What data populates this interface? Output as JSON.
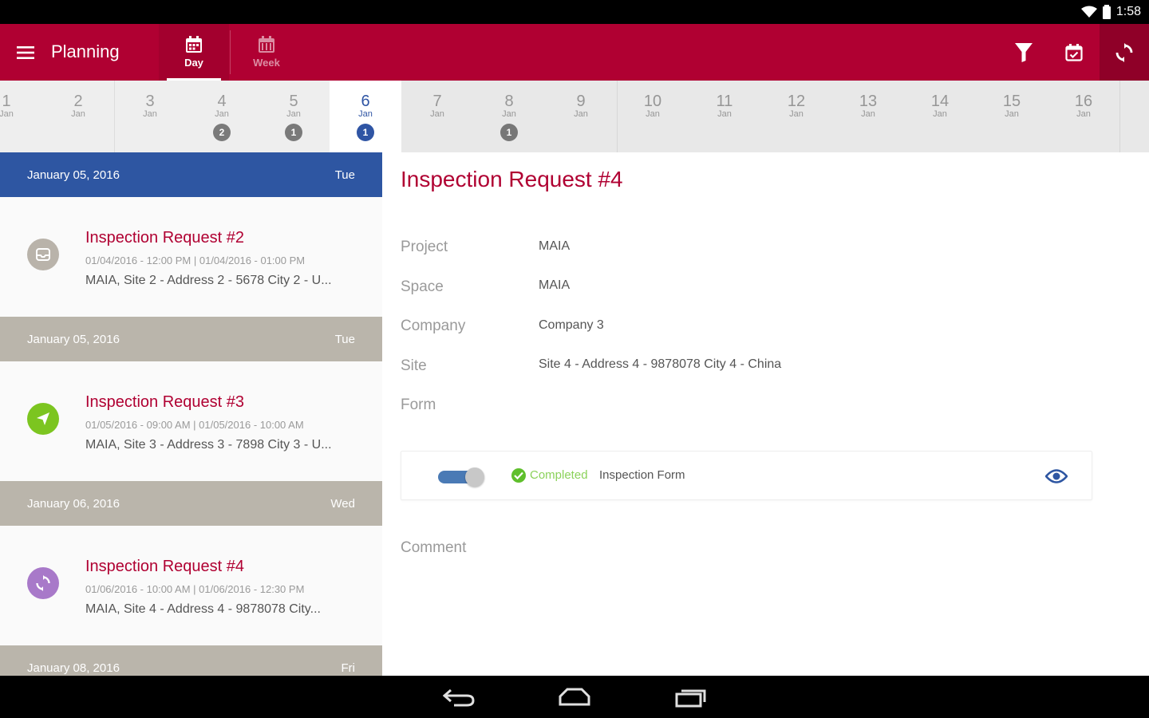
{
  "status_bar": {
    "time": "1:58"
  },
  "app_bar": {
    "title": "Planning",
    "view_tabs": [
      {
        "label": "Day",
        "icon": "calendar-day-icon"
      },
      {
        "label": "Week",
        "icon": "calendar-week-icon"
      }
    ],
    "actions": [
      {
        "icon": "filter-icon"
      },
      {
        "icon": "calendar-today-icon"
      },
      {
        "icon": "sync-icon"
      }
    ]
  },
  "date_strip": {
    "days": [
      {
        "num": "1",
        "month": "Jan",
        "count": ""
      },
      {
        "num": "2",
        "month": "Jan",
        "count": ""
      },
      {
        "num": "3",
        "month": "Jan",
        "count": ""
      },
      {
        "num": "4",
        "month": "Jan",
        "count": "2"
      },
      {
        "num": "5",
        "month": "Jan",
        "count": "1"
      },
      {
        "num": "6",
        "month": "Jan",
        "count": "1",
        "selected": true
      },
      {
        "num": "7",
        "month": "Jan",
        "count": ""
      },
      {
        "num": "8",
        "month": "Jan",
        "count": "1"
      },
      {
        "num": "9",
        "month": "Jan",
        "count": ""
      },
      {
        "num": "10",
        "month": "Jan",
        "count": ""
      },
      {
        "num": "11",
        "month": "Jan",
        "count": ""
      },
      {
        "num": "12",
        "month": "Jan",
        "count": ""
      },
      {
        "num": "13",
        "month": "Jan",
        "count": ""
      },
      {
        "num": "14",
        "month": "Jan",
        "count": ""
      },
      {
        "num": "15",
        "month": "Jan",
        "count": ""
      },
      {
        "num": "16",
        "month": "Jan",
        "count": ""
      }
    ]
  },
  "list": {
    "headers": [
      {
        "date": "January 05, 2016",
        "weekday": "Tue"
      },
      {
        "date": "January 05, 2016",
        "weekday": "Tue"
      },
      {
        "date": "January 06, 2016",
        "weekday": "Wed"
      },
      {
        "date": "January 08, 2016",
        "weekday": "Fri"
      }
    ],
    "items": [
      {
        "title": "Inspection Request #2",
        "time": "01/04/2016 - 12:00 PM | 01/04/2016 - 01:00 PM",
        "site": "MAIA, Site 2 - Address 2 - 5678 City 2 - U...",
        "icon": "inbox-icon",
        "color": "#b9b3aa"
      },
      {
        "title": "Inspection Request #3",
        "time": "01/05/2016 - 09:00 AM | 01/05/2016 - 10:00 AM",
        "site": "MAIA, Site 3 - Address 3 - 7898 City 3 - U...",
        "icon": "send-icon",
        "color": "#7cc520"
      },
      {
        "title": "Inspection Request #4",
        "time": "01/06/2016 - 10:00 AM | 01/06/2016 - 12:30 PM",
        "site": "MAIA, Site 4 - Address 4 - 9878078 City...",
        "icon": "sync-icon",
        "color": "#a879c9"
      }
    ]
  },
  "detail": {
    "title": "Inspection Request #4",
    "fields": [
      {
        "label": "Project",
        "value": "MAIA"
      },
      {
        "label": "Space",
        "value": "MAIA"
      },
      {
        "label": "Company",
        "value": "Company 3"
      },
      {
        "label": "Site",
        "value": "Site 4 - Address 4 - 9878078 City 4 - China"
      },
      {
        "label": "Form",
        "value": ""
      }
    ],
    "form": {
      "status": "Completed",
      "name": "Inspection Form",
      "enabled": true
    },
    "comment_label": "Comment"
  },
  "colors": {
    "brand": "#b00032",
    "selected_header": "#2e56a2",
    "date_header": "#bab5ab",
    "completed": "#5fbf2c"
  }
}
